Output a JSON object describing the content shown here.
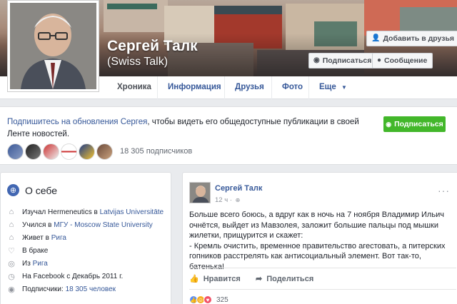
{
  "profile": {
    "name": "Сергей Талк",
    "alternate_name": "(Swiss Talk)"
  },
  "actions": {
    "add_friend": "Добавить в друзья",
    "follow": "Подписаться",
    "message": "Сообщение"
  },
  "tabs": [
    {
      "label": "Хроника"
    },
    {
      "label": "Информация"
    },
    {
      "label": "Друзья"
    },
    {
      "label": "Фото"
    },
    {
      "label": "Еще"
    }
  ],
  "subscribe": {
    "link_text": "Подпишитесь на обновления Сергея",
    "text": ", чтобы видеть его общедоступные публикации в своей Ленте новостей.",
    "button": "Подписаться",
    "count": "18 305 подписчиков"
  },
  "about": {
    "title": "О себе",
    "rows": [
      {
        "prefix": "Изучал Hermeneutics в ",
        "link": "Latvijas Universitāte",
        "icon": "graduation-icon"
      },
      {
        "prefix": "Учился в ",
        "link": "МГУ - Moscow State University",
        "icon": "graduation-icon"
      },
      {
        "prefix": "Живет в ",
        "link": "Рига",
        "icon": "home-icon"
      },
      {
        "prefix": "В браке",
        "link": "",
        "icon": "heart-icon"
      },
      {
        "prefix": "Из ",
        "link": "Рига",
        "icon": "location-icon"
      },
      {
        "prefix": "На Facebook с Декабрь 2011 г.",
        "link": "",
        "icon": "clock-icon"
      },
      {
        "prefix": "Подписчики: ",
        "link": "18 305 человек",
        "icon": "rss-icon"
      }
    ]
  },
  "post": {
    "author": "Сергей Талк",
    "time": "12 ч ·",
    "menu": "···",
    "text": "Больше всего боюсь, а вдруг как в ночь на 7 ноября Владимир Ильич очнётся, выйдет из Мавзолея, заложит большие пальцы под мышки жилетки, прищурится и скажет:\n- Кремль очистить, временное правительство агестовать, а питерских гопников расстрелять как антисоциальный элемент. Вот так-то, батенька!",
    "like": "Нравится",
    "share": "Поделиться",
    "reaction_count": "325"
  },
  "colors": {
    "link": "#365899",
    "green_button": "#42b72a",
    "page_bg": "#e9ebee"
  }
}
